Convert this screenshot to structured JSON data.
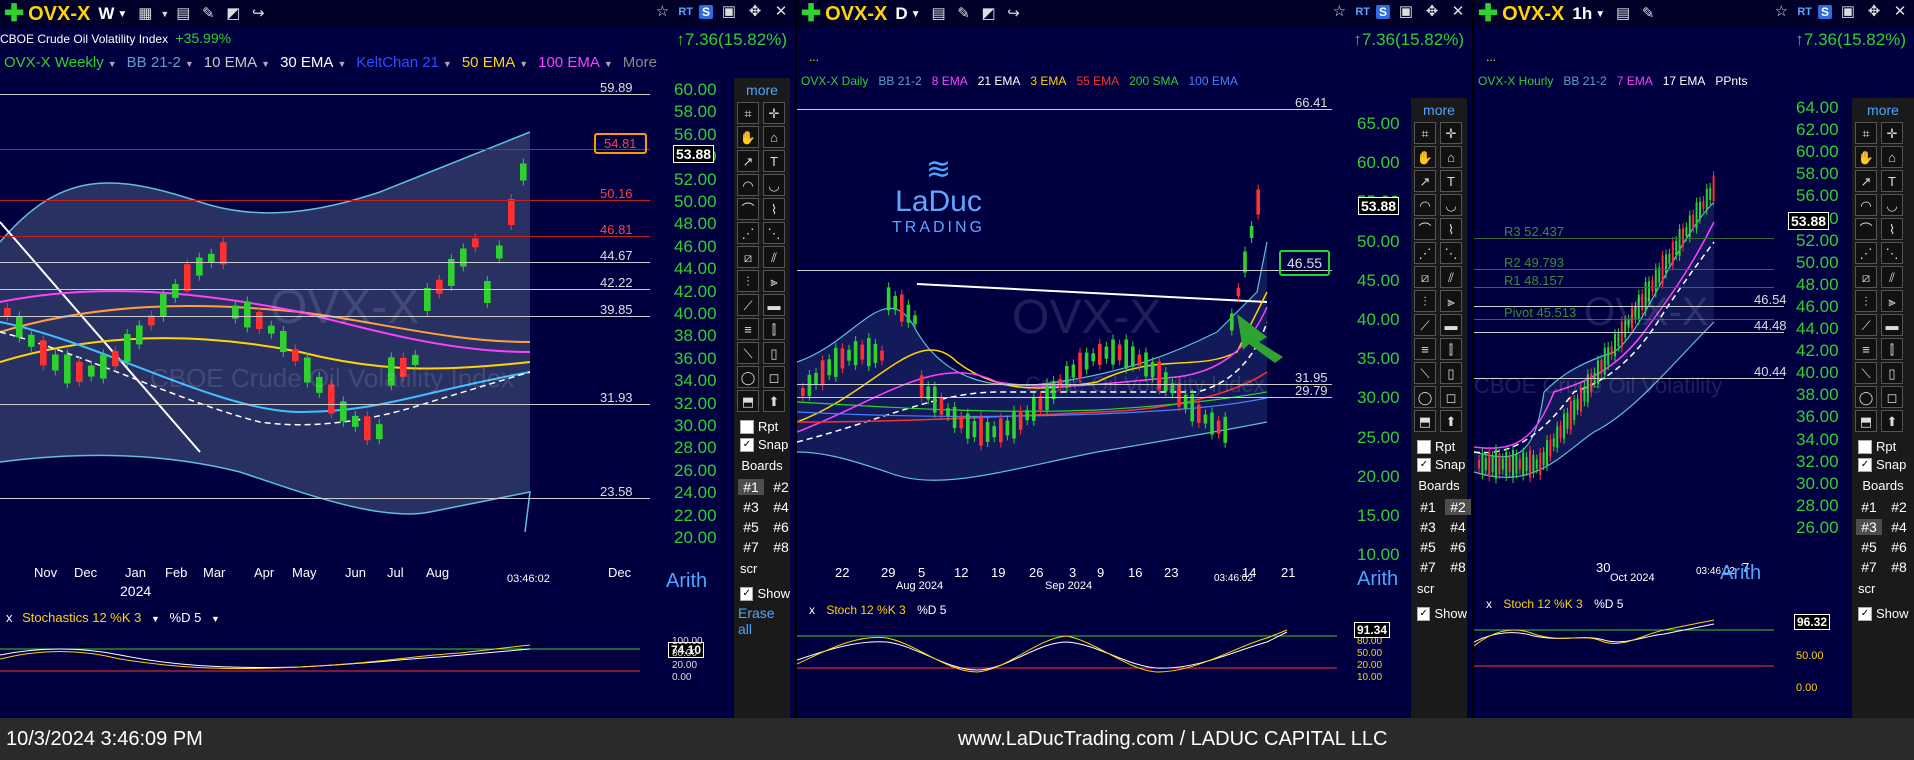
{
  "panels": [
    {
      "symbol": "OVX-X",
      "timeframe": "W",
      "change": "↑7.36(15.82%)",
      "subtitle": "CBOE Crude Oil Volatility Index",
      "subtitle_change": "+35.99%",
      "studies": [
        {
          "label": "OVX-X Weekly",
          "color": "#2fd12f"
        },
        {
          "label": "BB 21-2",
          "color": "#5fa0c0"
        },
        {
          "label": "10 EMA",
          "color": "#c8c8c8"
        },
        {
          "label": "30 EMA",
          "color": "#ffffff"
        },
        {
          "label": "KeltChan 21",
          "color": "#2a50ff"
        },
        {
          "label": "50 EMA",
          "color": "#ffd400"
        },
        {
          "label": "100 EMA",
          "color": "#ff40ff"
        },
        {
          "label": "More",
          "color": "#888888"
        }
      ],
      "y_axis": [
        "60.00",
        "58.00",
        "56.00",
        "54.00",
        "52.00",
        "50.00",
        "48.00",
        "46.00",
        "44.00",
        "42.00",
        "40.00",
        "38.00",
        "36.00",
        "34.00",
        "32.00",
        "30.00",
        "28.00",
        "26.00",
        "24.00",
        "22.00",
        "20.00"
      ],
      "levels": [
        {
          "label": "59.89",
          "color": "white"
        },
        {
          "label": "54.81",
          "color": "red"
        },
        {
          "label": "50.16",
          "color": "red"
        },
        {
          "label": "46.81",
          "color": "red"
        },
        {
          "label": "44.67",
          "color": "white"
        },
        {
          "label": "42.22",
          "color": "white"
        },
        {
          "label": "39.85",
          "color": "white"
        },
        {
          "label": "31.93",
          "color": "white"
        },
        {
          "label": "23.58",
          "color": "white"
        }
      ],
      "price": "53.88",
      "x_axis": [
        "Nov",
        "Dec",
        "Jan",
        "Feb",
        "Mar",
        "Apr",
        "May",
        "Jun",
        "Jul",
        "Aug",
        "Dec"
      ],
      "year": "2024",
      "time": "03:46:02",
      "scale": "Arith",
      "stoch": {
        "label": "Stochastics 12 %K 3",
        "d": "%D 5",
        "value": "74.10",
        "levels": [
          "100.00",
          "80.00",
          "20.00",
          "0.00"
        ]
      },
      "watermark": "OVX-X",
      "watermark_sub": "CBOE Crude Oil Volatility Index"
    },
    {
      "symbol": "OVX-X",
      "timeframe": "D",
      "change": "↑7.36(15.82%)",
      "studies": [
        {
          "label": "OVX-X Daily",
          "color": "#2fd12f"
        },
        {
          "label": "BB 21-2",
          "color": "#5fa0c0"
        },
        {
          "label": "8 EMA",
          "color": "#ff40ff"
        },
        {
          "label": "21 EMA",
          "color": "#ffffff"
        },
        {
          "label": "3 EMA",
          "color": "#ffd400"
        },
        {
          "label": "55 EMA",
          "color": "#ff3030"
        },
        {
          "label": "200 SMA",
          "color": "#2fd12f"
        },
        {
          "label": "100 EMA",
          "color": "#4d7dff"
        }
      ],
      "y_axis": [
        "65.00",
        "60.00",
        "55.00",
        "50.00",
        "45.00",
        "40.00",
        "35.00",
        "30.00",
        "25.00",
        "20.00",
        "15.00",
        "10.00"
      ],
      "levels": [
        {
          "label": "66.41",
          "color": "white"
        },
        {
          "label": "46.55",
          "color": "white"
        },
        {
          "label": "31.95",
          "color": "white"
        },
        {
          "label": "29.79",
          "color": "white"
        }
      ],
      "price": "53.88",
      "x_axis": [
        "22",
        "29",
        "5",
        "12",
        "19",
        "26",
        "3",
        "9",
        "16",
        "23",
        "14",
        "21"
      ],
      "months": [
        "Aug 2024",
        "Sep 2024"
      ],
      "time": "03:46:02",
      "scale": "Arith",
      "logo_main": "LaDuc",
      "logo_sub": "TRADING",
      "stoch": {
        "label": "Stoch 12 %K 3",
        "d": "%D 5",
        "value": "91.34",
        "levels": [
          "80.00",
          "50.00",
          "20.00",
          "10.00"
        ]
      },
      "watermark": "OVX-X",
      "watermark_sub": "Crude Oil Volatility Index"
    },
    {
      "symbol": "OVX-X",
      "timeframe": "1h",
      "change": "↑7.36(15.82%)",
      "studies": [
        {
          "label": "OVX-X Hourly",
          "color": "#2fd12f"
        },
        {
          "label": "BB 21-2",
          "color": "#5fa0c0"
        },
        {
          "label": "7 EMA",
          "color": "#ff40ff"
        },
        {
          "label": "17 EMA",
          "color": "#ffffff"
        },
        {
          "label": "PPnts",
          "color": "#ffffff"
        }
      ],
      "y_axis": [
        "64.00",
        "62.00",
        "60.00",
        "58.00",
        "56.00",
        "54.00",
        "52.00",
        "50.00",
        "48.00",
        "46.00",
        "44.00",
        "42.00",
        "40.00",
        "38.00",
        "36.00",
        "34.00",
        "32.00",
        "30.00",
        "28.00",
        "26.00"
      ],
      "pivots": [
        "R3 52.437",
        "R2 49.793",
        "R1 48.157",
        "Pivot 45.513"
      ],
      "levels": [
        {
          "label": "46.54",
          "color": "white"
        },
        {
          "label": "44.48",
          "color": "white"
        },
        {
          "label": "40.44",
          "color": "white"
        }
      ],
      "price": "53.88",
      "x_axis": [
        "30",
        "7"
      ],
      "months": [
        "Oct 2024"
      ],
      "time": "03:46:02",
      "scale": "Arith",
      "stoch": {
        "label": "Stoch 12 %K 3",
        "d": "%D 5",
        "value": "96.32",
        "levels": [
          "50.00",
          "0.00"
        ]
      },
      "watermark": "OVX-X",
      "watermark_sub": "CBOE Crude Oil Volatility"
    }
  ],
  "toolstrip": {
    "more": "more",
    "rpt": "Rpt",
    "snap": "Snap",
    "boards_title": "Boards",
    "boards": [
      "#1",
      "#2",
      "#3",
      "#4",
      "#5",
      "#6",
      "#7",
      "#8"
    ],
    "scr": "scr",
    "show": "Show",
    "erase_all": "Erase all"
  },
  "statusbar": {
    "datetime": "10/3/2024 3:46:09 PM",
    "footer": "www.LaDucTrading.com / LADUC CAPITAL LLC"
  }
}
